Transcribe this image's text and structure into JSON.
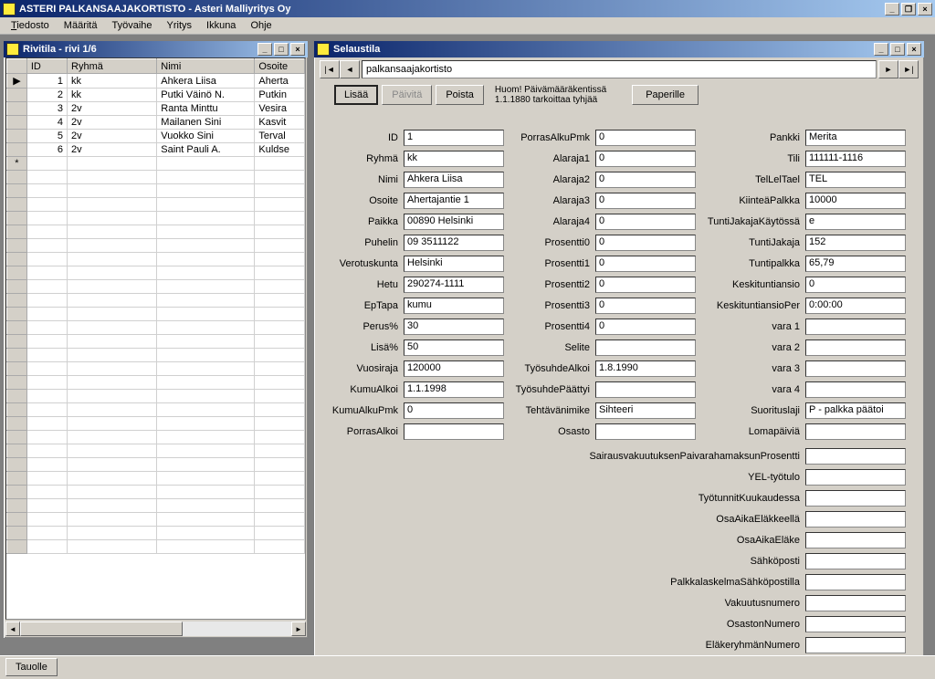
{
  "app": {
    "title": "ASTERI PALKANSAAJAKORTISTO - Asteri Malliyritys Oy",
    "footerBtn": "Tauolle"
  },
  "menu": {
    "tiedosto": "Tiedosto",
    "maarita": "Määritä",
    "tyovaihe": "Työvaihe",
    "yritys": "Yritys",
    "ikkuna": "Ikkuna",
    "ohje": "Ohje"
  },
  "left": {
    "title": "Rivitila - rivi 1/6",
    "headers": {
      "id": "ID",
      "ryhma": "Ryhmä",
      "nimi": "Nimi",
      "osoite": "Osoite"
    },
    "rows": [
      {
        "id": "1",
        "ryhma": "kk",
        "nimi": "Ahkera Liisa",
        "osoite": "Aherta"
      },
      {
        "id": "2",
        "ryhma": "kk",
        "nimi": "Putki Väinö N.",
        "osoite": "Putkin"
      },
      {
        "id": "3",
        "ryhma": "2v",
        "nimi": "Ranta Minttu",
        "osoite": "Vesira"
      },
      {
        "id": "4",
        "ryhma": "2v",
        "nimi": "Mailanen Sini",
        "osoite": "Kasvit"
      },
      {
        "id": "5",
        "ryhma": "2v",
        "nimi": "Vuokko Sini",
        "osoite": "Terval"
      },
      {
        "id": "6",
        "ryhma": "2v",
        "nimi": "Saint Pauli A.",
        "osoite": "Kuldse"
      }
    ]
  },
  "right": {
    "title": "Selaustila",
    "navValue": "palkansaajakortisto",
    "btnLisaa": "Lisää",
    "btnPaivita": "Päivitä",
    "btnPoista": "Poista",
    "btnPaperille": "Paperille",
    "note1": "Huom! Päivämääräkentissä",
    "note2": "1.1.1880 tarkoittaa tyhjää"
  },
  "fields": {
    "col1": [
      {
        "l": "ID",
        "v": "1"
      },
      {
        "l": "Ryhmä",
        "v": "kk"
      },
      {
        "l": "Nimi",
        "v": "Ahkera Liisa"
      },
      {
        "l": "Osoite",
        "v": "Ahertajantie 1"
      },
      {
        "l": "Paikka",
        "v": "00890 Helsinki"
      },
      {
        "l": "Puhelin",
        "v": "09 3511122"
      },
      {
        "l": "Verotuskunta",
        "v": "Helsinki"
      },
      {
        "l": "Hetu",
        "v": "290274-1111"
      },
      {
        "l": "EpTapa",
        "v": "kumu"
      },
      {
        "l": "Perus%",
        "v": "30"
      },
      {
        "l": "Lisä%",
        "v": "50"
      },
      {
        "l": "Vuosiraja",
        "v": "120000"
      },
      {
        "l": "KumuAlkoi",
        "v": "1.1.1998"
      },
      {
        "l": "KumuAlkuPmk",
        "v": "0"
      },
      {
        "l": "PorrasAlkoi",
        "v": ""
      }
    ],
    "col2": [
      {
        "l": "PorrasAlkuPmk",
        "v": "0"
      },
      {
        "l": "Alaraja1",
        "v": "0"
      },
      {
        "l": "Alaraja2",
        "v": "0"
      },
      {
        "l": "Alaraja3",
        "v": "0"
      },
      {
        "l": "Alaraja4",
        "v": "0"
      },
      {
        "l": "Prosentti0",
        "v": "0"
      },
      {
        "l": "Prosentti1",
        "v": "0"
      },
      {
        "l": "Prosentti2",
        "v": "0"
      },
      {
        "l": "Prosentti3",
        "v": "0"
      },
      {
        "l": "Prosentti4",
        "v": "0"
      },
      {
        "l": "Selite",
        "v": ""
      },
      {
        "l": "TyösuhdeAlkoi",
        "v": "1.8.1990"
      },
      {
        "l": "TyösuhdePäättyi",
        "v": ""
      },
      {
        "l": "Tehtävänimike",
        "v": "Sihteeri"
      },
      {
        "l": "Osasto",
        "v": ""
      }
    ],
    "col3": [
      {
        "l": "Pankki",
        "v": "Merita"
      },
      {
        "l": "Tili",
        "v": "111111-1116"
      },
      {
        "l": "TelLelTael",
        "v": "TEL"
      },
      {
        "l": "KiinteäPalkka",
        "v": "10000"
      },
      {
        "l": "TuntiJakajaKäytössä",
        "v": "e"
      },
      {
        "l": "TuntiJakaja",
        "v": "152"
      },
      {
        "l": "Tuntipalkka",
        "v": "65,79"
      },
      {
        "l": "Keskituntiansio",
        "v": "0"
      },
      {
        "l": "KeskituntiansioPer",
        "v": "0:00:00"
      },
      {
        "l": "vara 1",
        "v": ""
      },
      {
        "l": "vara 2",
        "v": ""
      },
      {
        "l": "vara 3",
        "v": ""
      },
      {
        "l": "vara 4",
        "v": ""
      },
      {
        "l": "Suorituslaji",
        "v": "P   - palkka päätoi"
      },
      {
        "l": "Lomapäiviä",
        "v": ""
      }
    ],
    "wide": [
      {
        "l": "SairausvakuutuksenPaivarahamaksunProsentti",
        "v": ""
      },
      {
        "l": "YEL-työtulo",
        "v": ""
      },
      {
        "l": "TyötunnitKuukaudessa",
        "v": ""
      },
      {
        "l": "OsaAikaEläkkeellä",
        "v": ""
      },
      {
        "l": "OsaAikaEläke",
        "v": ""
      },
      {
        "l": "Sähköposti",
        "v": ""
      },
      {
        "l": "PalkkalaskelmaSähköpostilla",
        "v": ""
      },
      {
        "l": "Vakuutusnumero",
        "v": ""
      },
      {
        "l": "OsastonNumero",
        "v": ""
      },
      {
        "l": "EläkeryhmänNumero",
        "v": ""
      }
    ]
  }
}
